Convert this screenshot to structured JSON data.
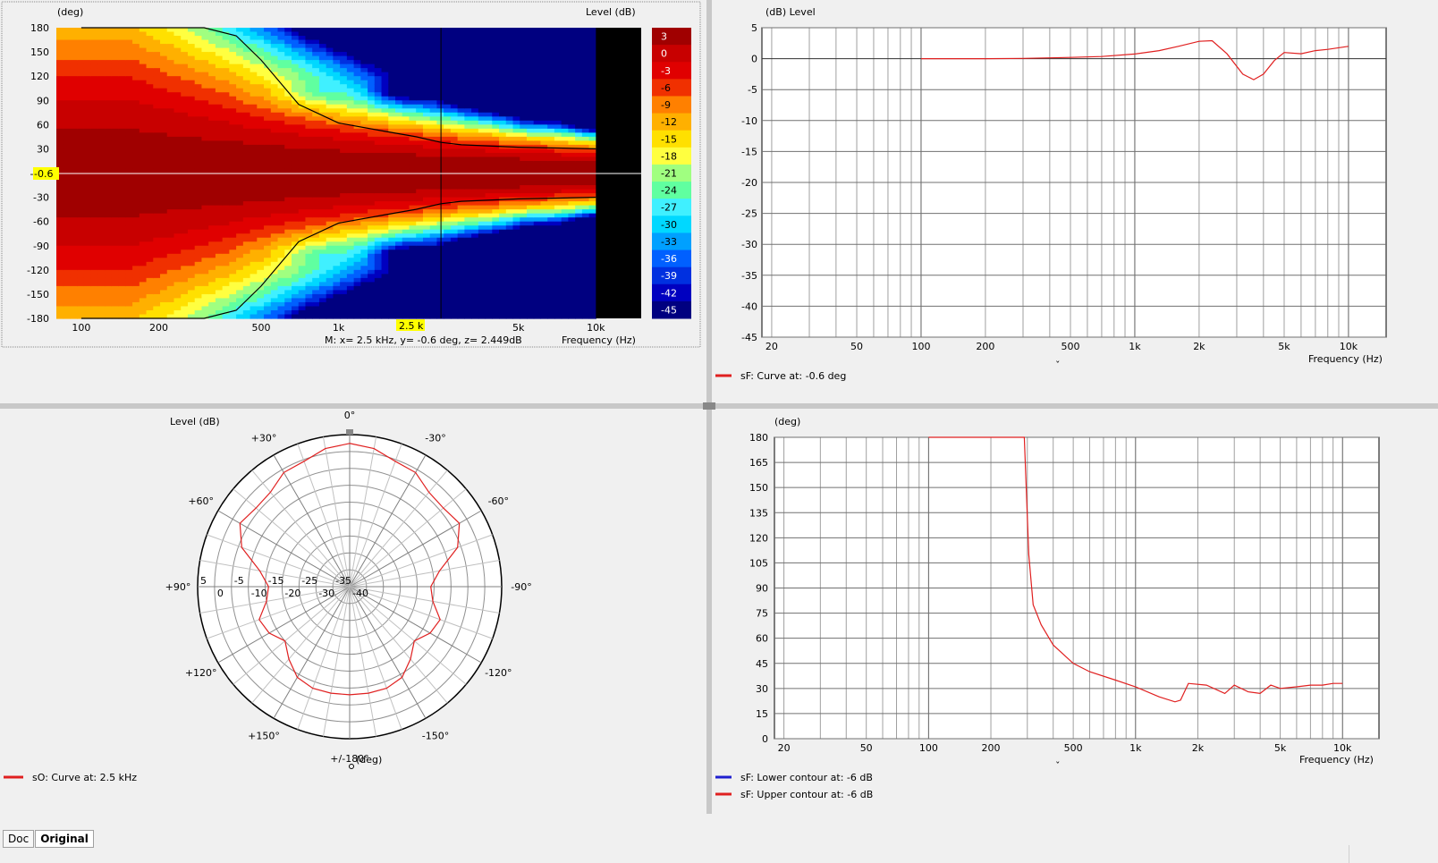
{
  "contour": {
    "y_unit": "(deg)",
    "z_label": "Level  (dB)",
    "x_label": "Frequency  (Hz)",
    "y_ticks": [
      "180",
      "150",
      "120",
      "90",
      "60",
      "30",
      "-0.6",
      "-30",
      "-60",
      "-90",
      "-120",
      "-150",
      "-180"
    ],
    "x_ticks": [
      "100",
      "200",
      "500",
      "1k",
      "2k",
      "5k",
      "10k"
    ],
    "cursor_x_label": "2.5 k",
    "cursor_y_label": "-0.6",
    "marker_readout": "M:  x= 2.5 kHz,  y= -0.6 deg, z= 2.449dB",
    "colorbar": [
      {
        "label": "3",
        "color": "#a00000"
      },
      {
        "label": "0",
        "color": "#c80000"
      },
      {
        "label": "-3",
        "color": "#e00000"
      },
      {
        "label": "-6",
        "color": "#f03000"
      },
      {
        "label": "-9",
        "color": "#ff8000"
      },
      {
        "label": "-12",
        "color": "#ffb000"
      },
      {
        "label": "-15",
        "color": "#ffe000"
      },
      {
        "label": "-18",
        "color": "#ffff40"
      },
      {
        "label": "-21",
        "color": "#a0ff80"
      },
      {
        "label": "-24",
        "color": "#60ffa0"
      },
      {
        "label": "-27",
        "color": "#40f0ff"
      },
      {
        "label": "-30",
        "color": "#00d8ff"
      },
      {
        "label": "-33",
        "color": "#00a0ff"
      },
      {
        "label": "-36",
        "color": "#0060ff"
      },
      {
        "label": "-39",
        "color": "#0030e0"
      },
      {
        "label": "-42",
        "color": "#0000c0"
      },
      {
        "label": "-45",
        "color": "#000080"
      }
    ]
  },
  "freq_response": {
    "y_unit": "(dB)  Level",
    "x_label": "Frequency  (Hz)",
    "legend": "sF: Curve at: -0.6 deg",
    "caret": "ˇ"
  },
  "polar": {
    "title": "Level  (dB)",
    "angle_labels": [
      "0°",
      "-30°",
      "-60°",
      "-90°",
      "-120°",
      "-150°",
      "+/-180°",
      "+150°",
      "+120°",
      "+90°",
      "+60°",
      "+30°"
    ],
    "ring_labels": [
      "5",
      "0",
      "-5",
      "-10",
      "-15",
      "-20",
      "-25",
      "-30",
      "-35",
      "-40"
    ],
    "unit": "(deg)",
    "legend": "sO: Curve at: 2.5 kHz"
  },
  "beamwidth": {
    "y_unit": "(deg)",
    "x_label": "Frequency  (Hz)",
    "legend_lower": "sF: Lower contour at: -6 dB",
    "legend_upper": "sF: Upper contour at: -6 dB",
    "caret": "ˇ"
  },
  "tabs": {
    "doc": "Doc",
    "original": "Original"
  },
  "chart_data": [
    {
      "type": "heatmap",
      "title": "",
      "xlabel": "Frequency  (Hz)",
      "ylabel": "(deg)",
      "zlabel": "Level  (dB)",
      "xscale": "log",
      "xlim": [
        80,
        15000
      ],
      "ylim": [
        -180,
        180
      ],
      "x_ticks": [
        100,
        200,
        500,
        1000,
        2000,
        5000,
        10000
      ],
      "y_ticks": [
        180,
        150,
        120,
        90,
        60,
        30,
        -0.6,
        -30,
        -60,
        -90,
        -120,
        -150,
        -180
      ],
      "zlim": [
        -45,
        3
      ],
      "data_upper_freq": 10000,
      "contour_level": -6,
      "contour": {
        "x": [
          100,
          200,
          300,
          400,
          500,
          700,
          1000,
          1500,
          2000,
          2500,
          3000,
          5000,
          10000
        ],
        "y": [
          180,
          180,
          180,
          170,
          140,
          85,
          62,
          52,
          45,
          38,
          35,
          32,
          30
        ]
      },
      "marker": {
        "x": 2500,
        "y": -0.6,
        "z": 2.449
      }
    },
    {
      "type": "line",
      "title": "",
      "ylabel": "(dB)  Level",
      "xlabel": "Frequency  (Hz)",
      "xscale": "log",
      "xlim": [
        18,
        15000
      ],
      "ylim": [
        -45,
        5
      ],
      "x_ticks": [
        20,
        50,
        100,
        200,
        500,
        1000,
        2000,
        5000,
        10000
      ],
      "y_ticks": [
        5,
        0,
        -5,
        -10,
        -15,
        -20,
        -25,
        -30,
        -35,
        -40,
        -45
      ],
      "series": [
        {
          "name": "sF: Curve at: -0.6 deg",
          "color": "#e02020",
          "x": [
            100,
            200,
            300,
            500,
            700,
            1000,
            1300,
            1600,
            2000,
            2300,
            2700,
            3200,
            3600,
            4000,
            4500,
            5000,
            6000,
            7000,
            8000,
            10000
          ],
          "y": [
            0,
            0,
            0.05,
            0.2,
            0.35,
            0.75,
            1.3,
            2.0,
            2.8,
            2.9,
            0.8,
            -2.5,
            -3.4,
            -2.5,
            -0.3,
            1.0,
            0.8,
            1.3,
            1.5,
            2.0
          ]
        }
      ]
    },
    {
      "type": "line",
      "title": "",
      "subtype": "polar",
      "zero_at": "top",
      "angle_direction": "counterclockwise-positive",
      "radial_label": "Level  (dB)",
      "rlim": [
        -40,
        5
      ],
      "r_ticks": [
        5,
        0,
        -5,
        -10,
        -15,
        -20,
        -25,
        -30,
        -35,
        -40
      ],
      "angle_ticks": [
        0,
        30,
        60,
        90,
        120,
        150,
        180,
        -150,
        -120,
        -90,
        -60,
        -30
      ],
      "series": [
        {
          "name": "sO: Curve at: 2.5 kHz",
          "color": "#e02020",
          "angle": [
            0,
            10,
            20,
            30,
            40,
            50,
            60,
            70,
            80,
            90,
            100,
            110,
            120,
            130,
            140,
            150,
            160,
            170,
            180
          ],
          "level": [
            2.4,
            1.5,
            -0.5,
            -1.0,
            -3.5,
            -3.8,
            -2.5,
            -6.0,
            -13.0,
            -16.0,
            -15.0,
            -11.5,
            -12.5,
            -15.0,
            -12.0,
            -9.0,
            -8.0,
            -8.0,
            -8.0
          ],
          "symmetric": true
        }
      ]
    },
    {
      "type": "line",
      "title": "",
      "ylabel": "(deg)",
      "xlabel": "Frequency  (Hz)",
      "xscale": "log",
      "xlim": [
        18,
        15000
      ],
      "ylim": [
        0,
        180
      ],
      "x_ticks": [
        20,
        50,
        100,
        200,
        500,
        1000,
        2000,
        5000,
        10000
      ],
      "y_ticks": [
        180,
        165,
        150,
        135,
        120,
        105,
        90,
        75,
        60,
        45,
        30,
        15,
        0
      ],
      "series": [
        {
          "name": "sF: Lower contour at: -6 dB",
          "color": "#2020d0",
          "x": [],
          "y": []
        },
        {
          "name": "sF: Upper contour at: -6 dB",
          "color": "#e02020",
          "x": [
            100,
            200,
            290,
            305,
            320,
            350,
            400,
            500,
            600,
            800,
            1000,
            1300,
            1550,
            1650,
            1800,
            2200,
            2700,
            3000,
            3500,
            4000,
            4500,
            5000,
            6000,
            7000,
            8000,
            9000,
            10000
          ],
          "y": [
            180,
            180,
            180,
            110,
            80,
            68,
            56,
            45,
            40,
            35,
            31,
            25,
            22,
            23,
            33,
            32,
            27,
            32,
            28,
            27,
            32,
            30,
            31,
            32,
            32,
            33,
            33
          ]
        }
      ]
    }
  ]
}
